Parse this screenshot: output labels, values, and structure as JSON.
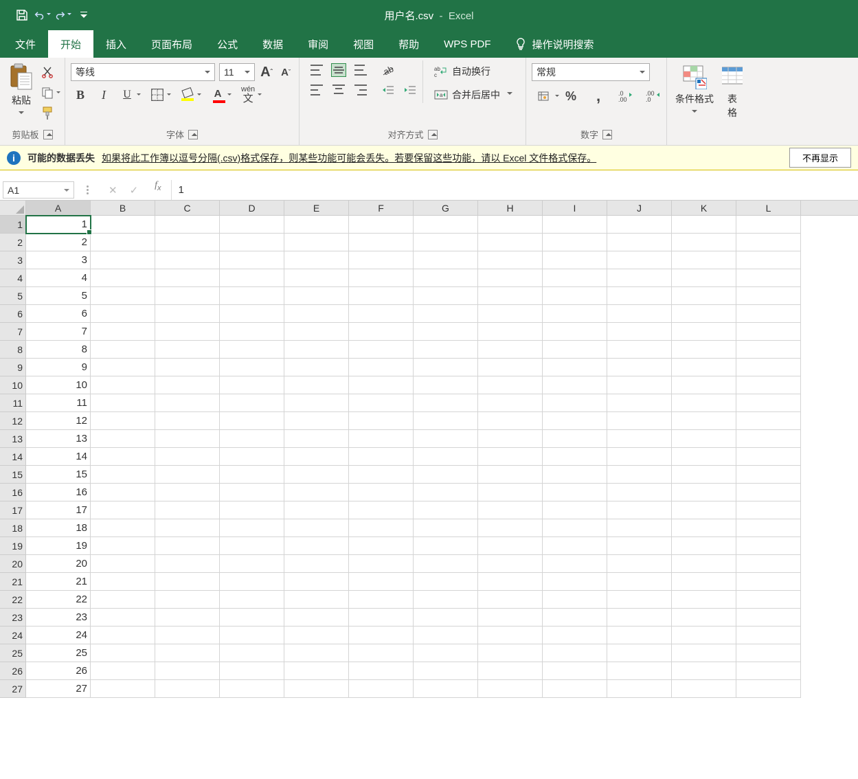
{
  "title": {
    "file": "用户名.csv",
    "sep": "-",
    "app": "Excel"
  },
  "qat": {
    "save": "save-icon",
    "undo": "undo-icon",
    "redo": "redo-icon",
    "custom": "customize-qat"
  },
  "tabs": [
    "文件",
    "开始",
    "插入",
    "页面布局",
    "公式",
    "数据",
    "审阅",
    "视图",
    "帮助",
    "WPS PDF"
  ],
  "tell_me": "操作说明搜索",
  "active_tab": 1,
  "ribbon": {
    "clipboard": {
      "paste": "粘贴",
      "label": "剪贴板"
    },
    "font": {
      "name": "等线",
      "size": "11",
      "increase": "A",
      "decrease": "A",
      "bold": "B",
      "italic": "I",
      "underline": "U",
      "phon_top": "wén",
      "phon_bot": "文",
      "fc_letter": "A",
      "label": "字体"
    },
    "align": {
      "wrap": "自动换行",
      "merge": "合并后居中",
      "label": "对齐方式"
    },
    "number": {
      "format": "常规",
      "pct": "%",
      "comma": ",",
      "label": "数字"
    },
    "styles": {
      "cond": "条件格式",
      "table": "表格",
      "label": ""
    }
  },
  "msg": {
    "title": "可能的数据丢失",
    "text": "如果将此工作簿以逗号分隔(.csv)格式保存，则某些功能可能会丢失。若要保留这些功能，请以 Excel 文件格式保存。",
    "btn": "不再显示"
  },
  "namebox": "A1",
  "fx_value": "1",
  "columns": [
    "A",
    "B",
    "C",
    "D",
    "E",
    "F",
    "G",
    "H",
    "I",
    "J",
    "K",
    "L"
  ],
  "rows": [
    1,
    2,
    3,
    4,
    5,
    6,
    7,
    8,
    9,
    10,
    11,
    12,
    13,
    14,
    15,
    16,
    17,
    18,
    19,
    20,
    21,
    22,
    23,
    24,
    25,
    26,
    27
  ],
  "cells": {
    "A": [
      "1",
      "2",
      "3",
      "4",
      "5",
      "6",
      "7",
      "8",
      "9",
      "10",
      "11",
      "12",
      "13",
      "14",
      "15",
      "16",
      "17",
      "18",
      "19",
      "20",
      "21",
      "22",
      "23",
      "24",
      "25",
      "26",
      "27"
    ]
  },
  "selected": "A1"
}
